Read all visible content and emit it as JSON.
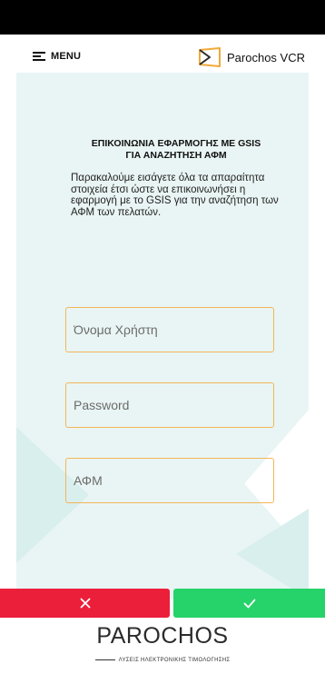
{
  "header": {
    "menu_label": "MENU",
    "brand_label": "Parochos VCR"
  },
  "main": {
    "title_line1": "ΕΠΙΚΟΙΝΩΝΙΑ ΕΦΑΡΜΟΓΗΣ ΜΕ GSIS",
    "title_line2": "ΓΙΑ ΑΝΑΖΗΤΗΣΗ ΑΦΜ",
    "description": "Παρακαλούμε εισάγετε όλα τα απαραίτητα στοιχεία έτσι ώστε να επικοινωνήσει η εφαρμογή με το GSIS για την αναζήτηση των ΑΦΜ των πελατών."
  },
  "form": {
    "username": {
      "placeholder": "Όνομα Χρήστη",
      "value": ""
    },
    "password": {
      "placeholder": "Password",
      "value": ""
    },
    "afm": {
      "placeholder": "ΑΦΜ",
      "value": ""
    }
  },
  "actions": {
    "cancel_icon": "close-icon",
    "confirm_icon": "check-icon"
  },
  "footer": {
    "logo_word": "PAROCHOS",
    "logo_tagline": "ΛΥΣΕΙΣ ΗΛΕΚΤΡΟΝΙΚΗΣ ΤΙΜΟΛΟΓΗΣΗΣ"
  },
  "colors": {
    "accent_field_border": "#f3b558",
    "cancel": "#ec1f3b",
    "confirm": "#26d36a",
    "brand_icon": "#f0a93a",
    "background_shape": "#e9f5f4"
  }
}
